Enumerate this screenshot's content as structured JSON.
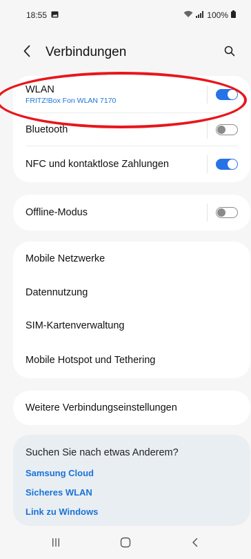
{
  "status_bar": {
    "time": "18:55",
    "battery": "100%"
  },
  "header": {
    "title": "Verbindungen"
  },
  "groups": {
    "wlan": {
      "label": "WLAN",
      "network": "FRITZ!Box Fon WLAN 7170",
      "on": true
    },
    "bluetooth": {
      "label": "Bluetooth",
      "on": false
    },
    "nfc": {
      "label": "NFC und kontaktlose Zahlungen",
      "on": true
    },
    "offline": {
      "label": "Offline-Modus",
      "on": false
    },
    "mobile_networks": {
      "label": "Mobile Netzwerke"
    },
    "data_usage": {
      "label": "Datennutzung"
    },
    "sim_manager": {
      "label": "SIM-Kartenverwaltung"
    },
    "hotspot": {
      "label": "Mobile Hotspot und Tethering"
    },
    "more_settings": {
      "label": "Weitere Verbindungseinstellungen"
    }
  },
  "suggestions": {
    "title": "Suchen Sie nach etwas Anderem?",
    "links": [
      "Samsung Cloud",
      "Sicheres WLAN",
      "Link zu Windows"
    ]
  },
  "colors": {
    "accent": "#2673e8",
    "link": "#1a73d6",
    "annotation": "#e8161b"
  },
  "icons": [
    "image-icon",
    "wifi-icon",
    "signal-icon",
    "battery-icon",
    "back-arrow-icon",
    "search-icon",
    "recents-icon",
    "home-icon",
    "nav-back-icon"
  ]
}
